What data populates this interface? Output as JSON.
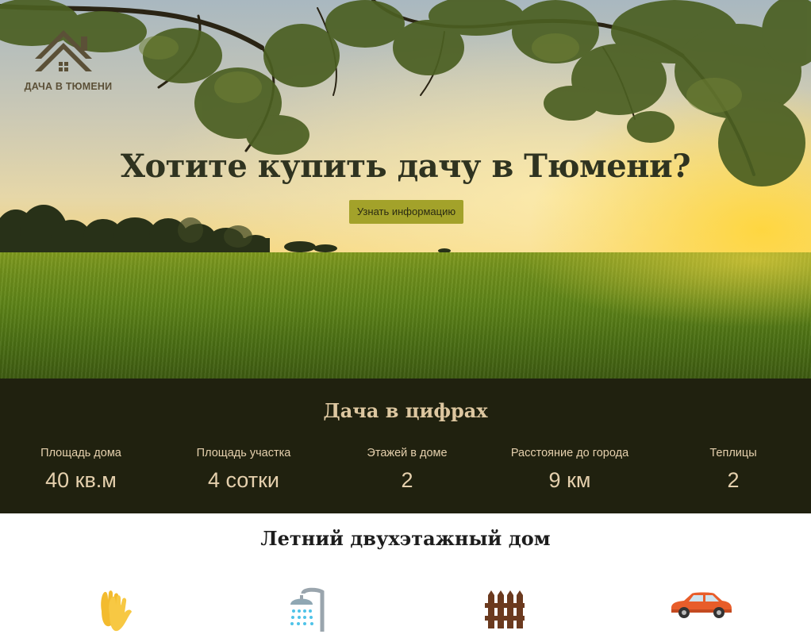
{
  "brand": {
    "name": "ДАЧА В ТЮМЕНИ",
    "icon": "house-roof-icon"
  },
  "hero": {
    "title": "Хотите купить дачу в Тюмени?",
    "button_label": "Узнать информацию"
  },
  "stats": {
    "title": "Дача в цифрах",
    "items": [
      {
        "label": "Площадь дома",
        "value": "40 кв.м"
      },
      {
        "label": "Площадь участка",
        "value": "4 сотки"
      },
      {
        "label": "Этажей в доме",
        "value": "2"
      },
      {
        "label": "Расстояние до города",
        "value": "9 км"
      },
      {
        "label": "Теплицы",
        "value": "2"
      }
    ]
  },
  "house": {
    "title": "Летний двухэтажный дом",
    "icons": [
      "gloves-icon",
      "shower-icon",
      "fence-icon",
      "car-icon"
    ]
  },
  "colors": {
    "stats_background": "#20210f",
    "stats_text": "#e5d0ad",
    "button_background": "#a3a22a",
    "logo_color": "#5b5037"
  }
}
